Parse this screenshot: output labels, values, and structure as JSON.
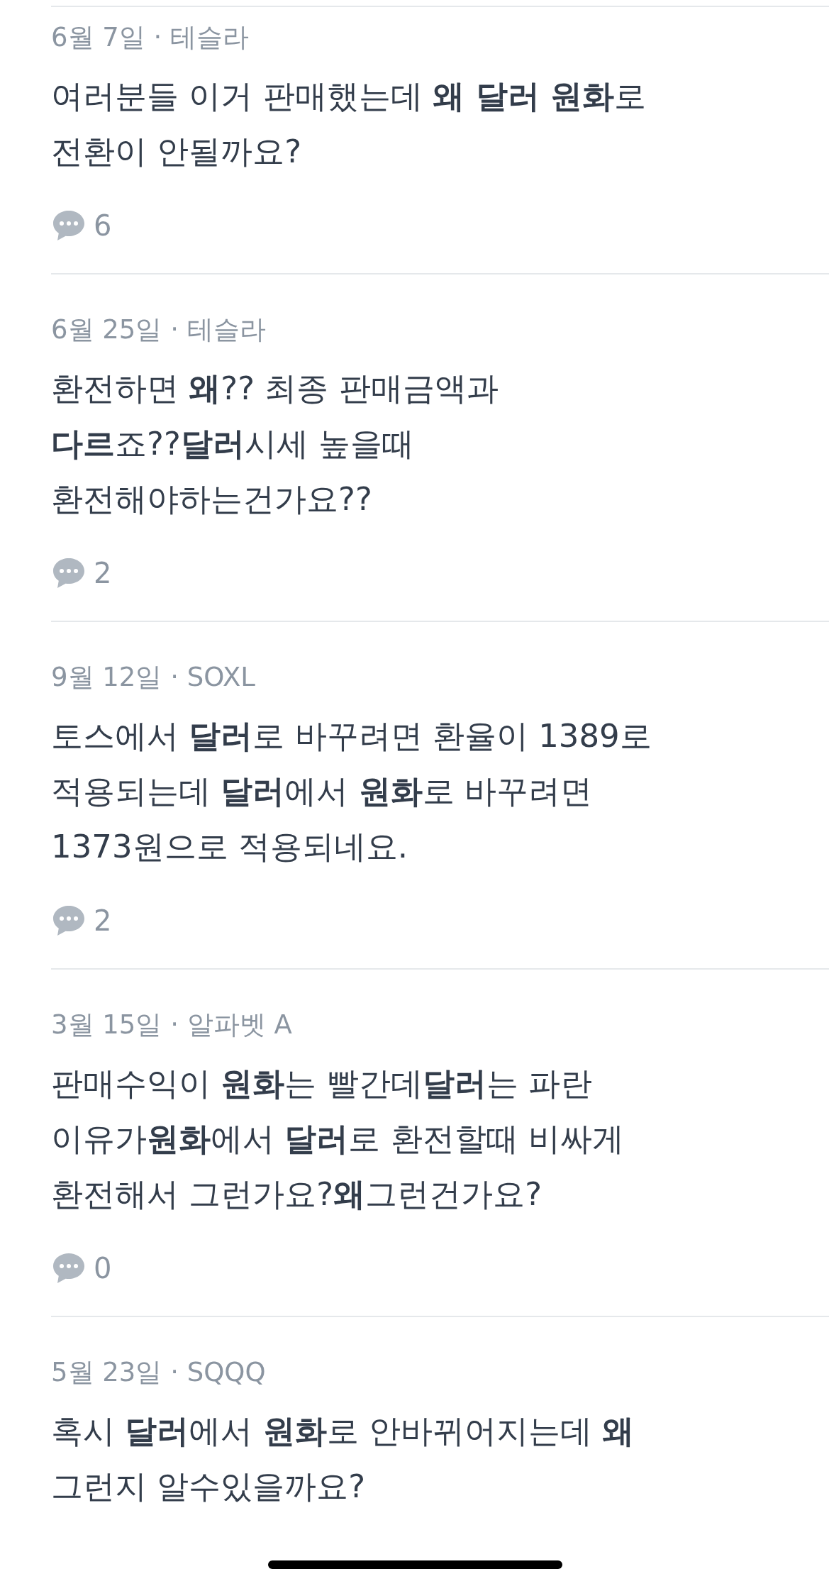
{
  "posts": [
    {
      "meta": "6월 7일 · 테슬라",
      "body": "여러분들 이거 판매했는데 **왜 달러 원화**로\n전환이 안될까요?",
      "comments": "6"
    },
    {
      "meta": "6월 25일 · 테슬라",
      "body": "환전하면 **왜**?? 최종 판매금액과\n**다르**죠??**달러**시세 높을때\n환전해야하는건가요??",
      "comments": "2"
    },
    {
      "meta": "9월 12일 · SOXL",
      "body": "토스에서 **달러**로 바꾸려면 환율이 1389로\n적용되는데 **달러**에서 **원화**로 바꾸려면\n1373원으로 적용되네요.",
      "comments": "2"
    },
    {
      "meta": "3월 15일 · 알파벳 A",
      "body": "판매수익이 **원화**는 빨간데**달러**는 파란\n이유가**원화**에서 **달러**로 환전할때 비싸게\n환전해서 그런가요?**왜**그런건가요?",
      "comments": "0"
    },
    {
      "meta": "5월 23일 · SQQQ",
      "body": "혹시 **달러**에서 **원화**로 안바뀌어지는데 **왜**\n그런지 알수있을까요?"
    }
  ]
}
